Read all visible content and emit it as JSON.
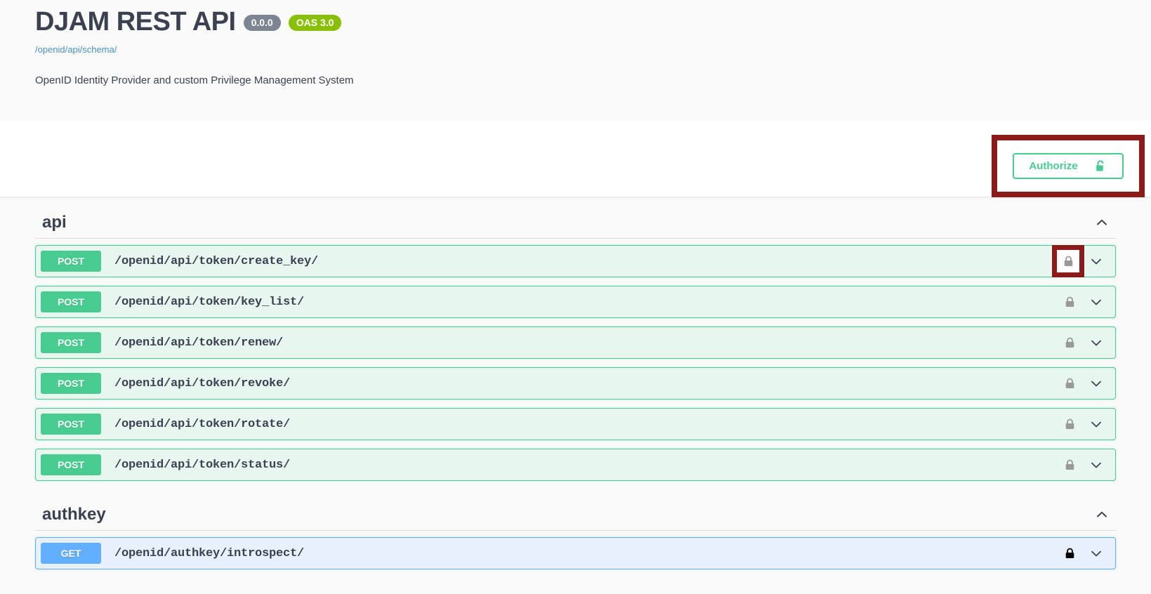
{
  "header": {
    "title": "DJAM REST API",
    "version_badge": "0.0.0",
    "oas_badge": "OAS 3.0",
    "schema_link": "/openid/api/schema/",
    "description": "OpenID Identity Provider and custom Privilege Management System"
  },
  "authorize": {
    "label": "Authorize",
    "icon": "unlock-icon",
    "highlighted": true,
    "highlight_color": "#8B1A1A"
  },
  "colors": {
    "post": "#49cc90",
    "get": "#61affe",
    "post_bg": "#e8f6f0",
    "get_bg": "#e8f0fb",
    "title": "#3b4151",
    "link": "#4a90c2",
    "oas_badge": "#89bf04",
    "version_badge": "#7d8492",
    "annotation": "#8B1A1A"
  },
  "sections": [
    {
      "name": "api",
      "expanded": true,
      "toggle_icon": "chevron-up-icon",
      "operations": [
        {
          "method": "POST",
          "path": "/openid/api/token/create_key/",
          "lock": "unlocked",
          "lock_highlighted": true,
          "toggle_icon": "chevron-down-icon"
        },
        {
          "method": "POST",
          "path": "/openid/api/token/key_list/",
          "lock": "unlocked",
          "lock_highlighted": false,
          "toggle_icon": "chevron-down-icon"
        },
        {
          "method": "POST",
          "path": "/openid/api/token/renew/",
          "lock": "unlocked",
          "lock_highlighted": false,
          "toggle_icon": "chevron-down-icon"
        },
        {
          "method": "POST",
          "path": "/openid/api/token/revoke/",
          "lock": "unlocked",
          "lock_highlighted": false,
          "toggle_icon": "chevron-down-icon"
        },
        {
          "method": "POST",
          "path": "/openid/api/token/rotate/",
          "lock": "unlocked",
          "lock_highlighted": false,
          "toggle_icon": "chevron-down-icon"
        },
        {
          "method": "POST",
          "path": "/openid/api/token/status/",
          "lock": "unlocked",
          "lock_highlighted": false,
          "toggle_icon": "chevron-down-icon"
        }
      ]
    },
    {
      "name": "authkey",
      "expanded": true,
      "toggle_icon": "chevron-up-icon",
      "operations": [
        {
          "method": "GET",
          "path": "/openid/authkey/introspect/",
          "lock": "locked",
          "lock_highlighted": false,
          "toggle_icon": "chevron-down-icon"
        }
      ]
    }
  ]
}
